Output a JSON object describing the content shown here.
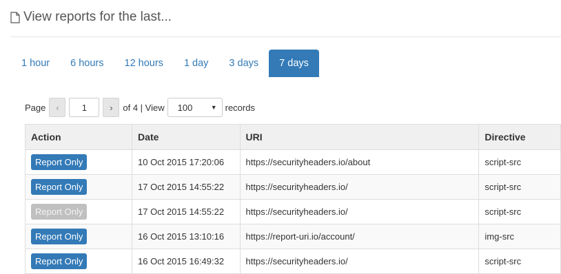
{
  "header": {
    "title": "View reports for the last...",
    "icon": "document-icon"
  },
  "tabs": [
    {
      "label": "1 hour",
      "active": false
    },
    {
      "label": "6 hours",
      "active": false
    },
    {
      "label": "12 hours",
      "active": false
    },
    {
      "label": "1 day",
      "active": false
    },
    {
      "label": "3 days",
      "active": false
    },
    {
      "label": "7 days",
      "active": true
    }
  ],
  "pager": {
    "page_label": "Page",
    "prev": "‹",
    "page_value": "1",
    "next": "›",
    "of_text": "of 4 | View",
    "view_value": "100",
    "records_label": "records"
  },
  "table": {
    "headers": {
      "action": "Action",
      "date": "Date",
      "uri": "URI",
      "directive": "Directive"
    },
    "rows": [
      {
        "action": "Report Only",
        "action_enabled": true,
        "date": "10 Oct 2015 17:20:06",
        "uri": "https://securityheaders.io/about",
        "directive": "script-src"
      },
      {
        "action": "Report Only",
        "action_enabled": true,
        "date": "17 Oct 2015 14:55:22",
        "uri": "https://securityheaders.io/",
        "directive": "script-src"
      },
      {
        "action": "Report Only",
        "action_enabled": false,
        "date": "17 Oct 2015 14:55:22",
        "uri": "https://securityheaders.io/",
        "directive": "script-src"
      },
      {
        "action": "Report Only",
        "action_enabled": true,
        "date": "16 Oct 2015 13:10:16",
        "uri": "https://report-uri.io/account/",
        "directive": "img-src"
      },
      {
        "action": "Report Only",
        "action_enabled": true,
        "date": "16 Oct 2015 16:49:32",
        "uri": "https://securityheaders.io/",
        "directive": "script-src"
      }
    ]
  },
  "colors": {
    "accent": "#337ab7",
    "disabled": "#c0c0c0"
  }
}
